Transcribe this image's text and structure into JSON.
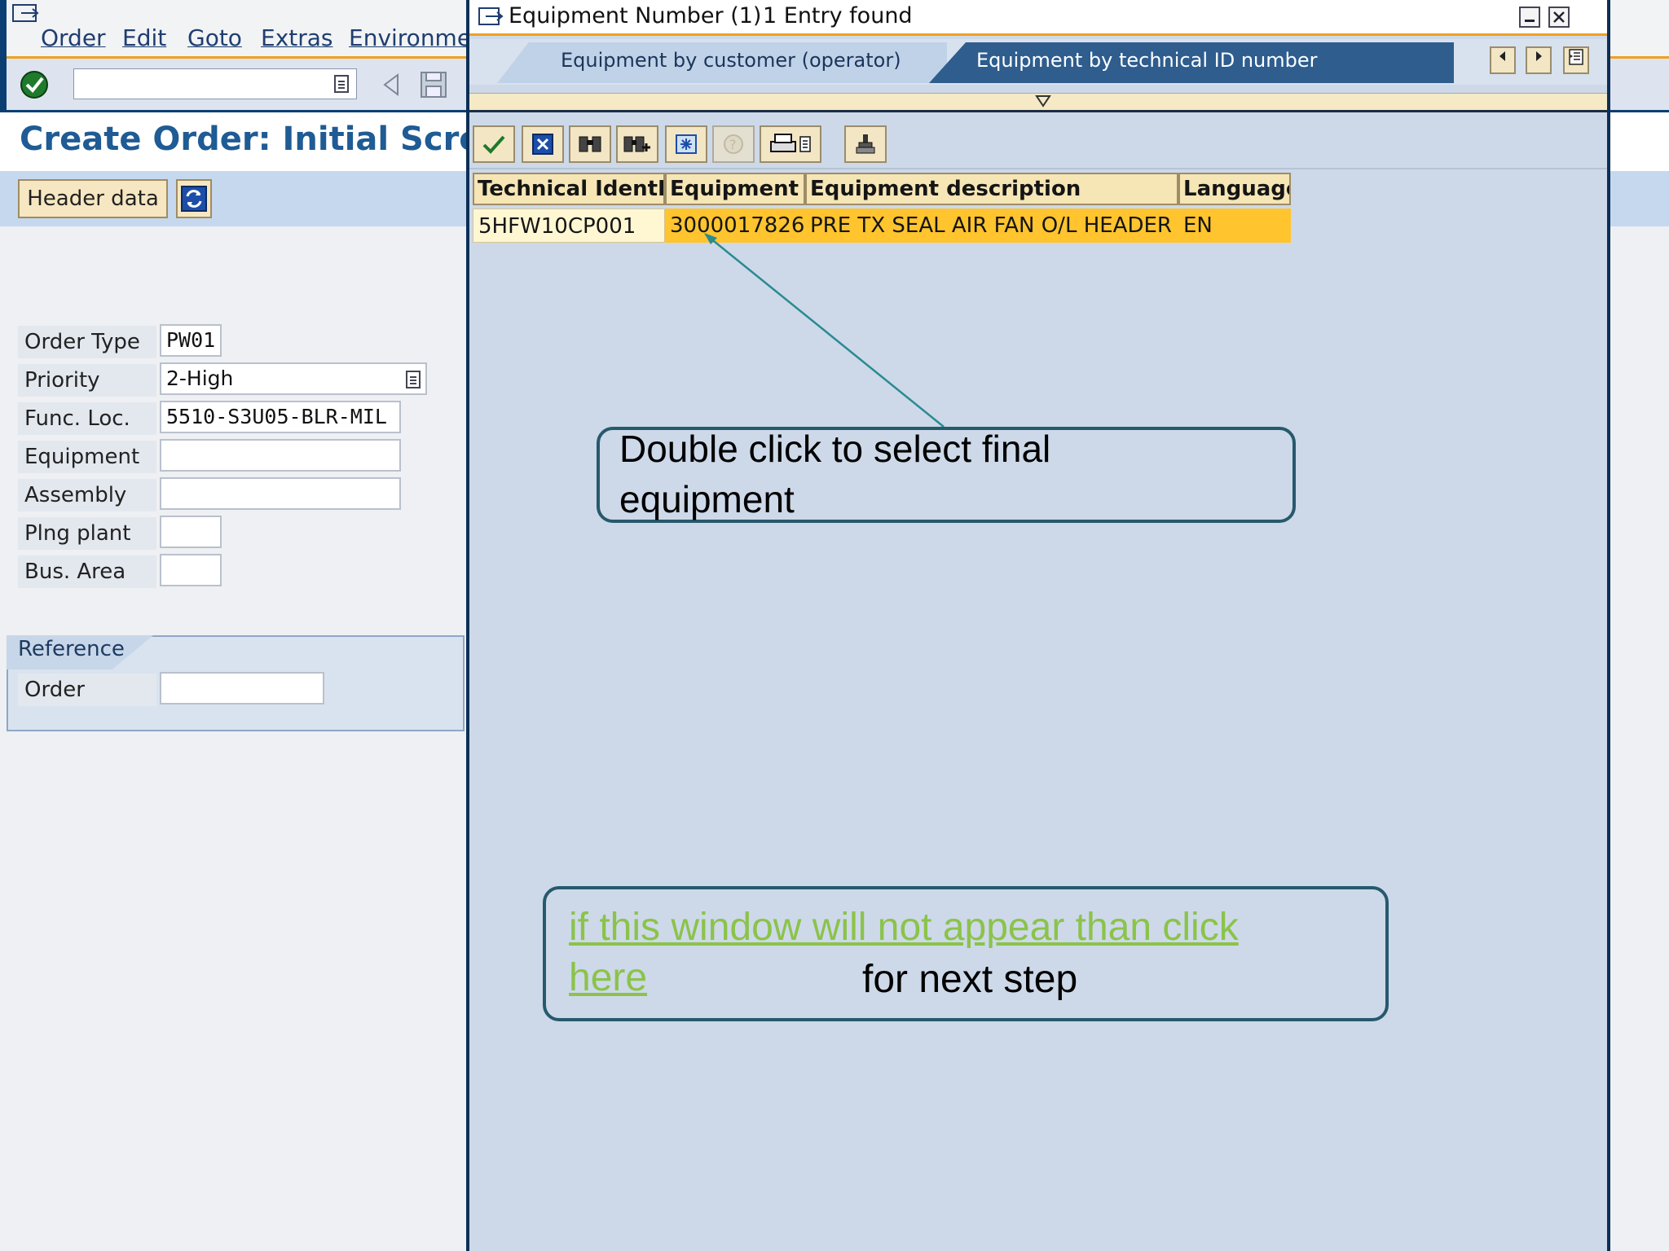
{
  "menu": {
    "order": "Order",
    "edit": "Edit",
    "goto": "Goto",
    "extras": "Extras",
    "environment": "Environmen"
  },
  "page": {
    "title": "Create Order: Initial Scree"
  },
  "app_toolbar": {
    "header_data": "Header data"
  },
  "form": {
    "fields": [
      {
        "label": "Order Type",
        "value": "PW01"
      },
      {
        "label": "Priority",
        "value": "2-High"
      },
      {
        "label": "Func. Loc.",
        "value": "5510-S3U05-BLR-MIL"
      },
      {
        "label": "Equipment",
        "value": ""
      },
      {
        "label": "Assembly",
        "value": ""
      },
      {
        "label": "Plng plant",
        "value": ""
      },
      {
        "label": "Bus. Area",
        "value": ""
      }
    ],
    "reference": {
      "title": "Reference",
      "order_label": "Order",
      "order_value": ""
    }
  },
  "popup": {
    "title": "Equipment Number (1)",
    "entries": "1 Entry found",
    "tabs": {
      "customer": "Equipment by customer (operator)",
      "technical": "Equipment by technical ID number"
    },
    "table": {
      "columns": [
        "Technical IdentN",
        "Equipment",
        "Equipment description",
        "Language"
      ],
      "rows": [
        [
          "5HFW10CP001",
          "3000017826",
          "PRE TX SEAL AIR FAN O/L HEADER",
          "EN"
        ]
      ]
    }
  },
  "callouts": {
    "select": "Double click to select final equipment",
    "link": "if this window will not appear than click here",
    "next": "for next step"
  },
  "colors": {
    "accent_orange": "#f0a020",
    "header_blue": "#1f5b94",
    "highlight_row": "#ffc42e",
    "callout_border": "#27596d",
    "link_green": "#8bc34a"
  }
}
